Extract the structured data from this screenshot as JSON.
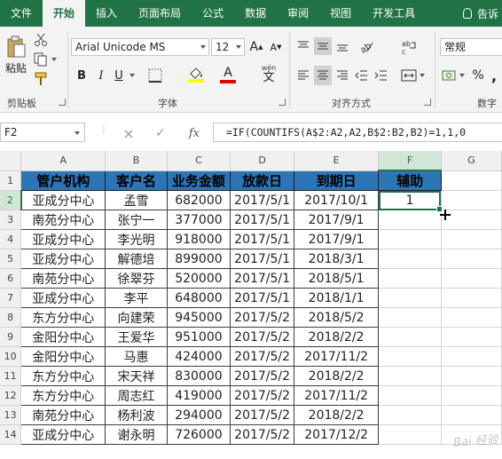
{
  "tabs": [
    "文件",
    "开始",
    "插入",
    "页面布局",
    "公式",
    "数据",
    "审阅",
    "视图",
    "开发工具"
  ],
  "active_tab": "开始",
  "tell_me": "告诉",
  "ribbon": {
    "clipboard": {
      "paste_label": "粘贴",
      "group_label": "剪贴板"
    },
    "font": {
      "name": "Arial Unicode MS",
      "size": "12",
      "bold": "B",
      "italic": "I",
      "underline": "U",
      "group_label": "字体",
      "wen_label": "wén"
    },
    "alignment": {
      "group_label": "对齐方式"
    },
    "number": {
      "format": "常规",
      "percent": "%",
      "comma": ",",
      "group_label": "数字"
    },
    "colors": {
      "fill": "#ffff00",
      "font": "#e00000",
      "brand": "#217346"
    }
  },
  "formula_bar": {
    "name_box": "F2",
    "fx": "fx",
    "formula": "=IF(COUNTIFS(A$2:A2,A2,B$2:B2,B2)=1,1,0"
  },
  "sheet": {
    "columns": [
      "A",
      "B",
      "C",
      "D",
      "E",
      "F",
      "G"
    ],
    "headers": [
      "管户机构",
      "客户名",
      "业务金额",
      "放款日",
      "到期日",
      "辅助"
    ],
    "rows": [
      {
        "n": "1"
      },
      {
        "n": "2",
        "cells": [
          "亚成分中心",
          "孟雪",
          "682000",
          "2017/5/1",
          "2017/10/1",
          "1"
        ]
      },
      {
        "n": "3",
        "cells": [
          "南苑分中心",
          "张宁一",
          "377000",
          "2017/5/1",
          "2017/9/1",
          ""
        ]
      },
      {
        "n": "4",
        "cells": [
          "亚成分中心",
          "李光明",
          "918000",
          "2017/5/1",
          "2017/9/1",
          ""
        ]
      },
      {
        "n": "5",
        "cells": [
          "亚成分中心",
          "解德培",
          "899000",
          "2017/5/1",
          "2018/3/1",
          ""
        ]
      },
      {
        "n": "6",
        "cells": [
          "南苑分中心",
          "徐翠芬",
          "520000",
          "2017/5/1",
          "2018/5/1",
          ""
        ]
      },
      {
        "n": "7",
        "cells": [
          "亚成分中心",
          "李平",
          "648000",
          "2017/5/1",
          "2018/1/1",
          ""
        ]
      },
      {
        "n": "8",
        "cells": [
          "东方分中心",
          "向建荣",
          "945000",
          "2017/5/2",
          "2018/5/2",
          ""
        ]
      },
      {
        "n": "9",
        "cells": [
          "金阳分中心",
          "王爱华",
          "951000",
          "2017/5/2",
          "2018/2/2",
          ""
        ]
      },
      {
        "n": "10",
        "cells": [
          "金阳分中心",
          "马惠",
          "424000",
          "2017/5/2",
          "2017/11/2",
          ""
        ]
      },
      {
        "n": "11",
        "cells": [
          "东方分中心",
          "宋天祥",
          "830000",
          "2017/5/2",
          "2018/2/2",
          ""
        ]
      },
      {
        "n": "12",
        "cells": [
          "东方分中心",
          "周志红",
          "419000",
          "2017/5/2",
          "2017/11/2",
          ""
        ]
      },
      {
        "n": "13",
        "cells": [
          "南苑分中心",
          "杨利波",
          "294000",
          "2017/5/2",
          "2018/2/2",
          ""
        ]
      },
      {
        "n": "14",
        "cells": [
          "亚成分中心",
          "谢永明",
          "726000",
          "2017/5/2",
          "2017/12/2",
          ""
        ]
      }
    ]
  },
  "watermark": "Bai 经验"
}
